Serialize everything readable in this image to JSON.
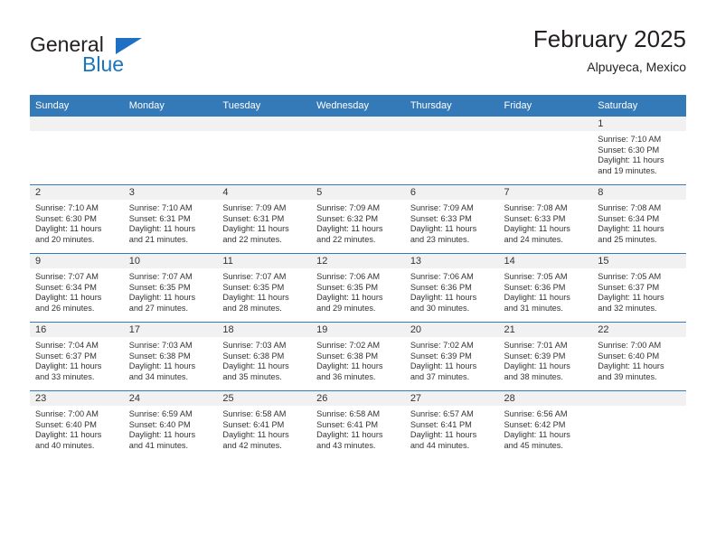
{
  "brand": {
    "name_top": "General",
    "name_bottom": "Blue",
    "triangle_color": "#1f6fc4",
    "blue_color": "#1b75bb"
  },
  "header": {
    "title": "February 2025",
    "subtitle": "Alpuyeca, Mexico"
  },
  "theme": {
    "header_bar_color": "#3479b8",
    "daynum_bar_color": "#f1f1f1",
    "text_color": "#333333"
  },
  "weekday_headers": [
    "Sunday",
    "Monday",
    "Tuesday",
    "Wednesday",
    "Thursday",
    "Friday",
    "Saturday"
  ],
  "weeks": [
    [
      {
        "day": ""
      },
      {
        "day": ""
      },
      {
        "day": ""
      },
      {
        "day": ""
      },
      {
        "day": ""
      },
      {
        "day": ""
      },
      {
        "day": "1",
        "sunrise": "Sunrise: 7:10 AM",
        "sunset": "Sunset: 6:30 PM",
        "daylight_line1": "Daylight: 11 hours",
        "daylight_line2": "and 19 minutes."
      }
    ],
    [
      {
        "day": "2",
        "sunrise": "Sunrise: 7:10 AM",
        "sunset": "Sunset: 6:30 PM",
        "daylight_line1": "Daylight: 11 hours",
        "daylight_line2": "and 20 minutes."
      },
      {
        "day": "3",
        "sunrise": "Sunrise: 7:10 AM",
        "sunset": "Sunset: 6:31 PM",
        "daylight_line1": "Daylight: 11 hours",
        "daylight_line2": "and 21 minutes."
      },
      {
        "day": "4",
        "sunrise": "Sunrise: 7:09 AM",
        "sunset": "Sunset: 6:31 PM",
        "daylight_line1": "Daylight: 11 hours",
        "daylight_line2": "and 22 minutes."
      },
      {
        "day": "5",
        "sunrise": "Sunrise: 7:09 AM",
        "sunset": "Sunset: 6:32 PM",
        "daylight_line1": "Daylight: 11 hours",
        "daylight_line2": "and 22 minutes."
      },
      {
        "day": "6",
        "sunrise": "Sunrise: 7:09 AM",
        "sunset": "Sunset: 6:33 PM",
        "daylight_line1": "Daylight: 11 hours",
        "daylight_line2": "and 23 minutes."
      },
      {
        "day": "7",
        "sunrise": "Sunrise: 7:08 AM",
        "sunset": "Sunset: 6:33 PM",
        "daylight_line1": "Daylight: 11 hours",
        "daylight_line2": "and 24 minutes."
      },
      {
        "day": "8",
        "sunrise": "Sunrise: 7:08 AM",
        "sunset": "Sunset: 6:34 PM",
        "daylight_line1": "Daylight: 11 hours",
        "daylight_line2": "and 25 minutes."
      }
    ],
    [
      {
        "day": "9",
        "sunrise": "Sunrise: 7:07 AM",
        "sunset": "Sunset: 6:34 PM",
        "daylight_line1": "Daylight: 11 hours",
        "daylight_line2": "and 26 minutes."
      },
      {
        "day": "10",
        "sunrise": "Sunrise: 7:07 AM",
        "sunset": "Sunset: 6:35 PM",
        "daylight_line1": "Daylight: 11 hours",
        "daylight_line2": "and 27 minutes."
      },
      {
        "day": "11",
        "sunrise": "Sunrise: 7:07 AM",
        "sunset": "Sunset: 6:35 PM",
        "daylight_line1": "Daylight: 11 hours",
        "daylight_line2": "and 28 minutes."
      },
      {
        "day": "12",
        "sunrise": "Sunrise: 7:06 AM",
        "sunset": "Sunset: 6:35 PM",
        "daylight_line1": "Daylight: 11 hours",
        "daylight_line2": "and 29 minutes."
      },
      {
        "day": "13",
        "sunrise": "Sunrise: 7:06 AM",
        "sunset": "Sunset: 6:36 PM",
        "daylight_line1": "Daylight: 11 hours",
        "daylight_line2": "and 30 minutes."
      },
      {
        "day": "14",
        "sunrise": "Sunrise: 7:05 AM",
        "sunset": "Sunset: 6:36 PM",
        "daylight_line1": "Daylight: 11 hours",
        "daylight_line2": "and 31 minutes."
      },
      {
        "day": "15",
        "sunrise": "Sunrise: 7:05 AM",
        "sunset": "Sunset: 6:37 PM",
        "daylight_line1": "Daylight: 11 hours",
        "daylight_line2": "and 32 minutes."
      }
    ],
    [
      {
        "day": "16",
        "sunrise": "Sunrise: 7:04 AM",
        "sunset": "Sunset: 6:37 PM",
        "daylight_line1": "Daylight: 11 hours",
        "daylight_line2": "and 33 minutes."
      },
      {
        "day": "17",
        "sunrise": "Sunrise: 7:03 AM",
        "sunset": "Sunset: 6:38 PM",
        "daylight_line1": "Daylight: 11 hours",
        "daylight_line2": "and 34 minutes."
      },
      {
        "day": "18",
        "sunrise": "Sunrise: 7:03 AM",
        "sunset": "Sunset: 6:38 PM",
        "daylight_line1": "Daylight: 11 hours",
        "daylight_line2": "and 35 minutes."
      },
      {
        "day": "19",
        "sunrise": "Sunrise: 7:02 AM",
        "sunset": "Sunset: 6:38 PM",
        "daylight_line1": "Daylight: 11 hours",
        "daylight_line2": "and 36 minutes."
      },
      {
        "day": "20",
        "sunrise": "Sunrise: 7:02 AM",
        "sunset": "Sunset: 6:39 PM",
        "daylight_line1": "Daylight: 11 hours",
        "daylight_line2": "and 37 minutes."
      },
      {
        "day": "21",
        "sunrise": "Sunrise: 7:01 AM",
        "sunset": "Sunset: 6:39 PM",
        "daylight_line1": "Daylight: 11 hours",
        "daylight_line2": "and 38 minutes."
      },
      {
        "day": "22",
        "sunrise": "Sunrise: 7:00 AM",
        "sunset": "Sunset: 6:40 PM",
        "daylight_line1": "Daylight: 11 hours",
        "daylight_line2": "and 39 minutes."
      }
    ],
    [
      {
        "day": "23",
        "sunrise": "Sunrise: 7:00 AM",
        "sunset": "Sunset: 6:40 PM",
        "daylight_line1": "Daylight: 11 hours",
        "daylight_line2": "and 40 minutes."
      },
      {
        "day": "24",
        "sunrise": "Sunrise: 6:59 AM",
        "sunset": "Sunset: 6:40 PM",
        "daylight_line1": "Daylight: 11 hours",
        "daylight_line2": "and 41 minutes."
      },
      {
        "day": "25",
        "sunrise": "Sunrise: 6:58 AM",
        "sunset": "Sunset: 6:41 PM",
        "daylight_line1": "Daylight: 11 hours",
        "daylight_line2": "and 42 minutes."
      },
      {
        "day": "26",
        "sunrise": "Sunrise: 6:58 AM",
        "sunset": "Sunset: 6:41 PM",
        "daylight_line1": "Daylight: 11 hours",
        "daylight_line2": "and 43 minutes."
      },
      {
        "day": "27",
        "sunrise": "Sunrise: 6:57 AM",
        "sunset": "Sunset: 6:41 PM",
        "daylight_line1": "Daylight: 11 hours",
        "daylight_line2": "and 44 minutes."
      },
      {
        "day": "28",
        "sunrise": "Sunrise: 6:56 AM",
        "sunset": "Sunset: 6:42 PM",
        "daylight_line1": "Daylight: 11 hours",
        "daylight_line2": "and 45 minutes."
      },
      {
        "day": ""
      }
    ]
  ]
}
